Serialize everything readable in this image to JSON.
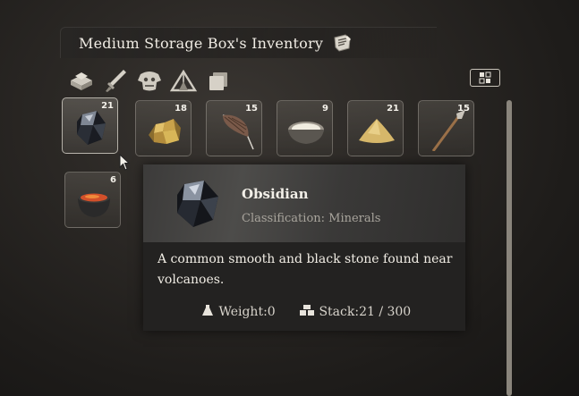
{
  "window": {
    "title": "Medium Storage Box's Inventory",
    "title_icon": "crafting-scroll-icon"
  },
  "categories": [
    {
      "name": "building-materials-icon"
    },
    {
      "name": "weapons-icon"
    },
    {
      "name": "armor-icon"
    },
    {
      "name": "camp-icon"
    },
    {
      "name": "misc-items-icon"
    }
  ],
  "sort_button": {
    "icon": "sort-grid-icon"
  },
  "slots": [
    {
      "item": "Obsidian",
      "count": "21",
      "icon": "obsidian-icon"
    },
    {
      "item": "Gold ore",
      "count": "18",
      "icon": "gold-ore-icon"
    },
    {
      "item": "Feather",
      "count": "15",
      "icon": "feather-icon"
    },
    {
      "item": "Bowl",
      "count": "9",
      "icon": "bowl-icon"
    },
    {
      "item": "Powder",
      "count": "21",
      "icon": "powder-pile-icon"
    },
    {
      "item": "Spear",
      "count": "15",
      "icon": "spear-icon"
    },
    {
      "item": "Cauldron",
      "count": "6",
      "icon": "cauldron-icon"
    }
  ],
  "tooltip": {
    "name": "Obsidian",
    "classification": "Classification: Minerals",
    "description": "A common smooth and black stone found near volcanoes.",
    "weight_label": "Weight:",
    "weight_value": "0",
    "stack_label": "Stack:",
    "stack_value": "21 / 300"
  },
  "colors": {
    "background": "#2b2825",
    "tooltip_bg": "#232221",
    "text": "#f0ece4",
    "muted_text": "#a8a49c"
  }
}
